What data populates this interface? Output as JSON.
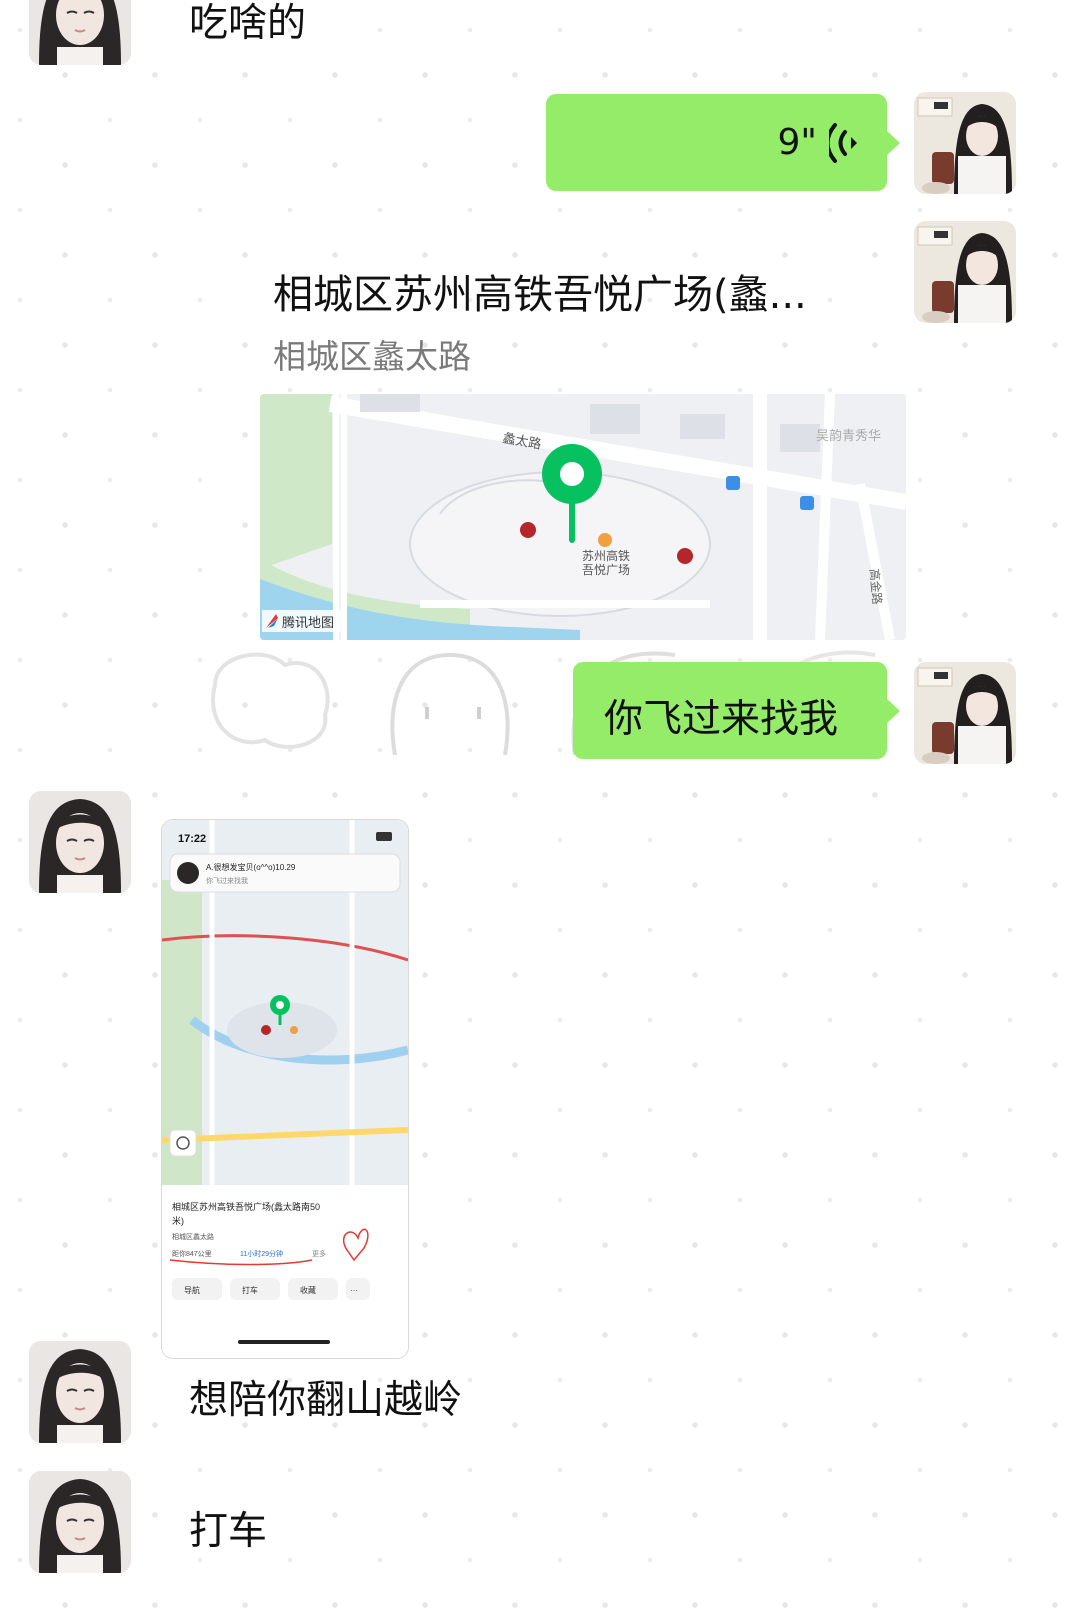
{
  "messages": {
    "m1_text": "吃啥的",
    "voice_duration": "9\"",
    "location": {
      "title": "相城区苏州高铁吾悦广场(蠡...",
      "address": "相城区蠡太路",
      "map_provider": "腾讯地图",
      "road_label": "蠡太路",
      "poi_label": "苏州高铁\n吾悦广场",
      "corner_label": "吴韵青秀华",
      "side_road": "高金路"
    },
    "m4_text": "你飞过来找我",
    "screenshot": {
      "time": "17:22",
      "notif_title": "A.很想发宝贝(o^^o)10.29",
      "notif_sub": "你飞过来找我",
      "card_title": "相城区苏州高铁吾悦广场(蠡太路南50米)",
      "card_addr": "相城区蠡太路",
      "card_distance": "距你847公里",
      "card_time": "11小时29分钟",
      "card_more": "更多",
      "btn_nav": "导航",
      "btn_taxi": "打车",
      "btn_fav": "收藏",
      "btn_more": "···"
    },
    "m6_text": "想陪你翻山越岭",
    "m7_text": "打车"
  },
  "colors": {
    "bubble_green": "#95ec69",
    "pin_green": "#07c160",
    "background": "#ffffff"
  },
  "icons": {
    "voice": "voice-wave-icon",
    "pin": "location-pin-icon"
  }
}
